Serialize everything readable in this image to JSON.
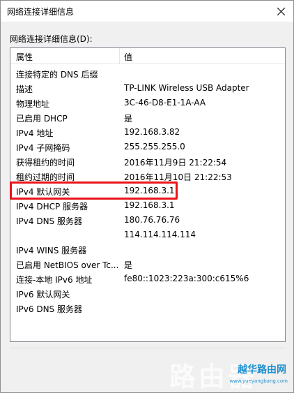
{
  "window": {
    "title": "网络连接详细信息"
  },
  "details_label": "网络连接详细信息(D):",
  "columns": {
    "property": "属性",
    "value": "值"
  },
  "rows": [
    {
      "prop": "连接特定的 DNS 后缀",
      "val": ""
    },
    {
      "prop": "描述",
      "val": "TP-LINK Wireless USB Adapter"
    },
    {
      "prop": "物理地址",
      "val": "3C-46-D8-E1-1A-AA"
    },
    {
      "prop": "已启用 DHCP",
      "val": "是"
    },
    {
      "prop": "IPv4 地址",
      "val": "192.168.3.82"
    },
    {
      "prop": "IPv4 子网掩码",
      "val": "255.255.255.0"
    },
    {
      "prop": "获得租约的时间",
      "val": "2016年11月9日 21:22:54"
    },
    {
      "prop": "租约过期的时间",
      "val": "2016年11月10日 21:22:53"
    },
    {
      "prop": "IPv4 默认网关",
      "val": "192.168.3.1"
    },
    {
      "prop": "IPv4 DHCP 服务器",
      "val": "192.168.3.1"
    },
    {
      "prop": "IPv4 DNS 服务器",
      "val": "180.76.76.76"
    },
    {
      "prop": "",
      "val": "114.114.114.114"
    },
    {
      "prop": "IPv4 WINS 服务器",
      "val": ""
    },
    {
      "prop": "已启用 NetBIOS over Tc...",
      "val": "是"
    },
    {
      "prop": "连接-本地 IPv6 地址",
      "val": "fe80::1023:223a:300:c615%6"
    },
    {
      "prop": "IPv6 默认网关",
      "val": ""
    },
    {
      "prop": "IPv6 DNS 服务器",
      "val": ""
    }
  ],
  "watermark": {
    "big": "路由器",
    "brand": "越华路由网",
    "url": "www.yueyangbang.com"
  },
  "colors": {
    "highlight": "#e8131b",
    "brand": "#1f8fcf"
  }
}
